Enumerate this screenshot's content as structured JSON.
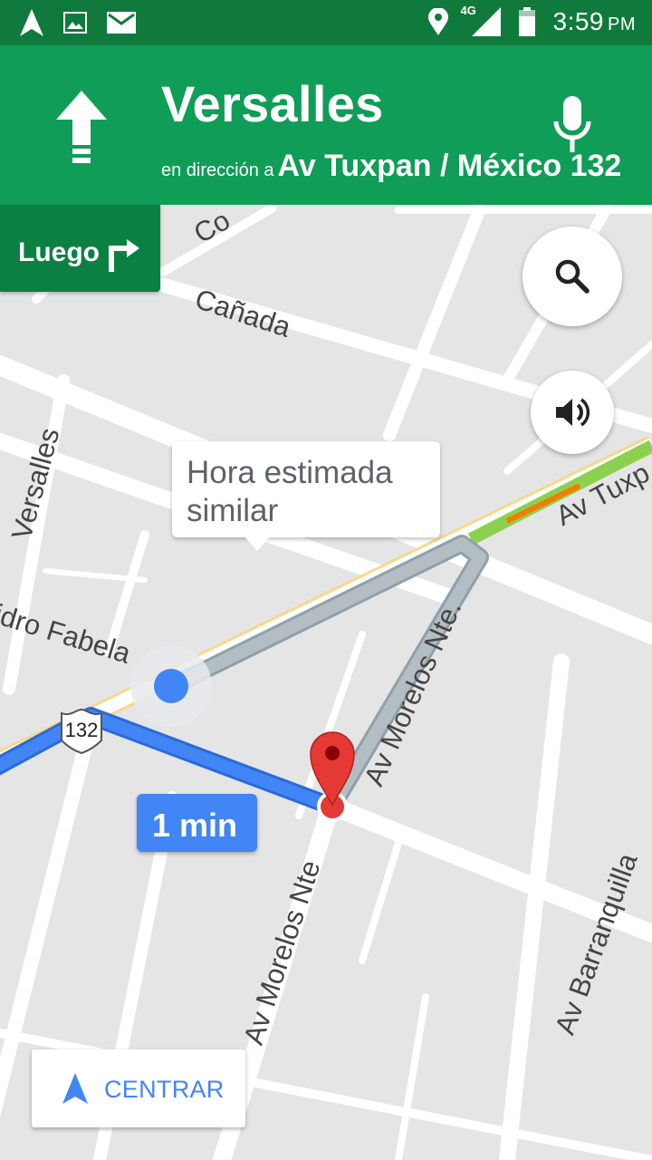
{
  "status_bar": {
    "time": "3:59",
    "ampm": "PM",
    "network": "4G",
    "icons": [
      "navigation-icon",
      "image-icon",
      "mail-icon",
      "location-icon",
      "signal-icon",
      "battery-icon"
    ]
  },
  "navigation": {
    "street": "Versalles",
    "prefix": "en dirección a",
    "destination": "Av Tuxpan / México 132",
    "icons": [
      "straight-arrow-icon",
      "mic-icon"
    ]
  },
  "then_instruction": {
    "label": "Luego",
    "icon": "turn-right-icon"
  },
  "buttons": {
    "search_icon": "search-icon",
    "sound_icon": "volume-icon"
  },
  "callout": {
    "text": "Hora estimada similar"
  },
  "eta": {
    "text": "1 min"
  },
  "route_shield": {
    "text": "132"
  },
  "recenter": {
    "label": "CENTRAR",
    "icon": "navigation-arrow-icon"
  },
  "map_labels": {
    "top_cut": "Co",
    "canada": "Cañada",
    "versalles": "Versalles",
    "fabela": "idro Fabela",
    "tuxpan": "Av Tuxp",
    "morelos_upper": "Av Morelos Nte.",
    "morelos_lower": "Av Morelos Nte",
    "barranquilla": "Av Barranquilla"
  },
  "colors": {
    "status_bar": "#0f7a3c",
    "nav_banner": "#0f9d58",
    "then_banner": "#0b8043",
    "route_blue": "#4285f4",
    "alt_route": "#a6b3ba",
    "pin_red": "#e53935"
  }
}
